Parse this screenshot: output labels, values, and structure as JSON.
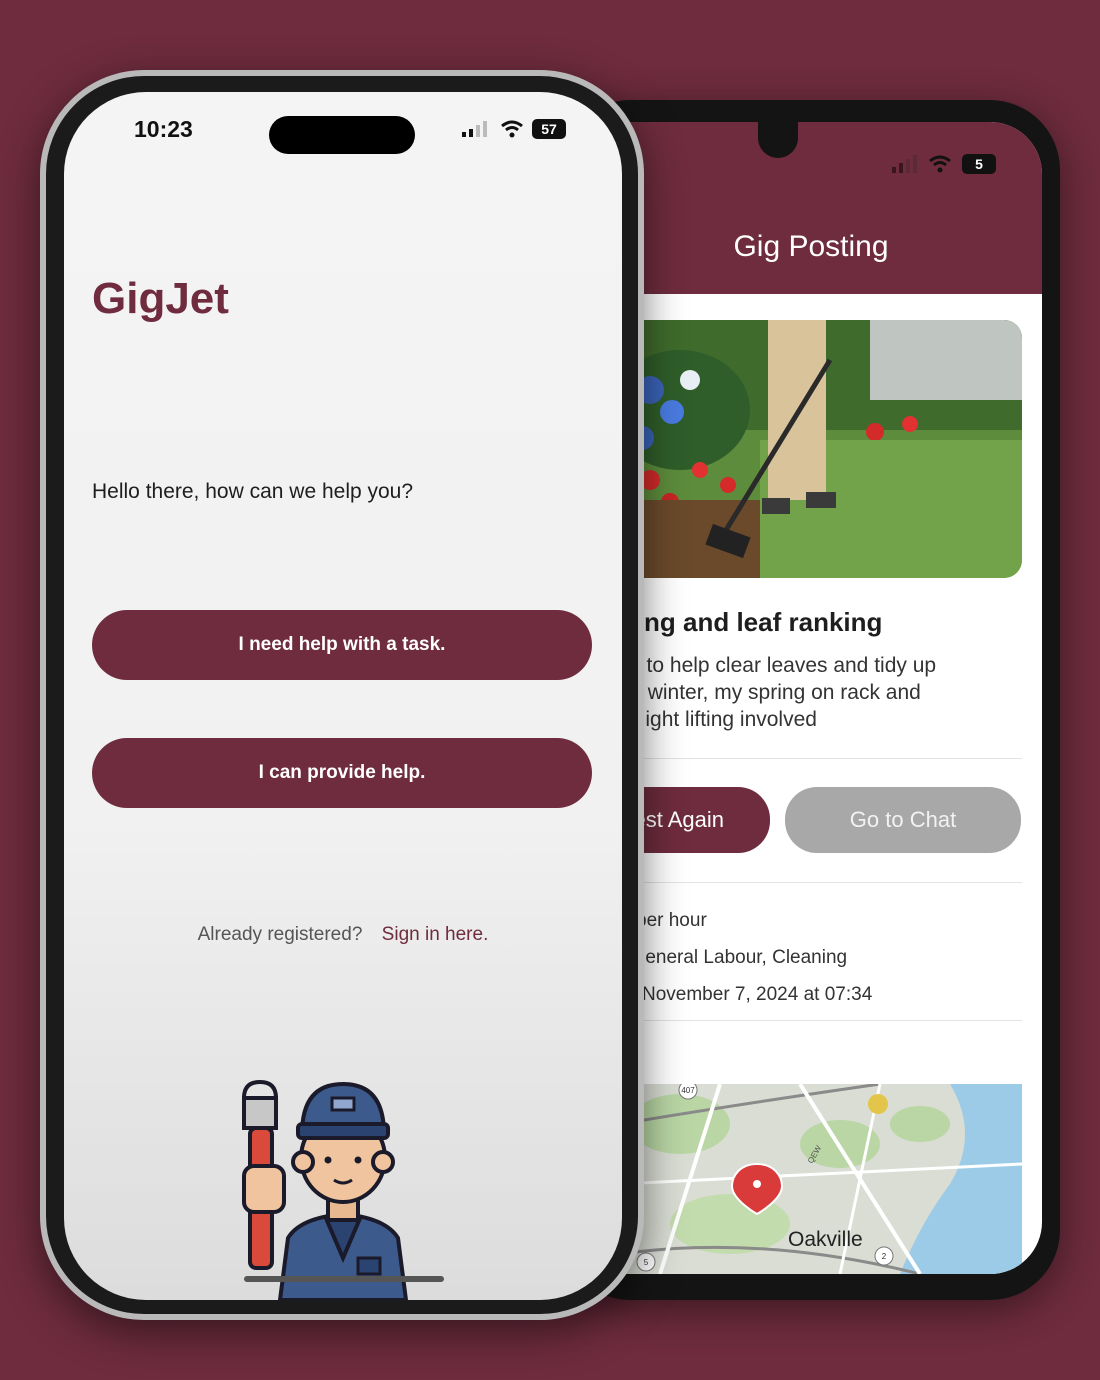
{
  "back_phone": {
    "status": {
      "battery": "5"
    },
    "header_title": "Gig Posting",
    "gig": {
      "title": "eaning and leaf ranking",
      "description_lines": [
        "eone to help clear leaves and tidy up",
        "efore winter, my spring on rack and",
        "ome light lifting involved"
      ]
    },
    "buttons": {
      "request_again": "est Again",
      "go_to_chat": "Go to Chat"
    },
    "details": {
      "rate": "per hour",
      "categories": ": General Labour, Cleaning",
      "posted": "November 7, 2024 at 07:34"
    },
    "map": {
      "city_label": "Oakville",
      "road_badges": [
        "407",
        "5",
        "2",
        "QEW"
      ]
    }
  },
  "front_phone": {
    "status": {
      "time": "10:23",
      "battery": "57"
    },
    "brand": "GigJet",
    "greeting": "Hello there, how can we help you?",
    "buttons": {
      "need_help": "I need help with a task.",
      "provide_help": "I can provide help."
    },
    "signin": {
      "prompt": "Already registered?",
      "link": "Sign in here."
    }
  },
  "colors": {
    "brand": "#6e2c3e",
    "background": "#6e2c3e",
    "secondary_button": "#a8a8a8"
  }
}
